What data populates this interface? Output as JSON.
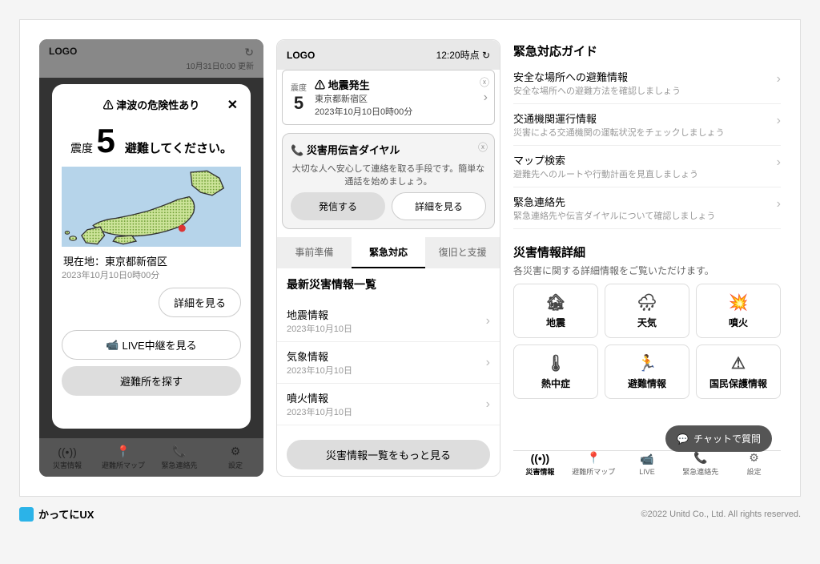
{
  "phone1": {
    "logo": "LOGO",
    "updated": "10月31日0:00 更新",
    "modal": {
      "header": "津波の危険性あり",
      "level_label": "震度",
      "level_num": "5",
      "evac_msg": "避難してください。",
      "loc_label": "現在地：東京都新宿区",
      "time": "2023年10月10日0時00分",
      "detail_btn": "詳細を見る",
      "live_btn": "LIVE中継を見る",
      "shelter_btn": "避難所を探す"
    },
    "tabs": [
      "災害情報",
      "避難所マップ",
      "緊急連絡先",
      "設定"
    ]
  },
  "phone2": {
    "logo": "LOGO",
    "time": "12:20時点",
    "alert": {
      "level_label": "震度",
      "level_num": "5",
      "title": "地震発生",
      "loc": "東京都新宿区",
      "time": "2023年10月10日0時00分"
    },
    "dengon": {
      "title": "災害用伝言ダイヤル",
      "desc": "大切な人へ安心して連絡を取る手段です。簡単な通話を始めましょう。",
      "call": "発信する",
      "detail": "詳細を見る"
    },
    "tabs": [
      "事前準備",
      "緊急対応",
      "復旧と支援"
    ],
    "list_title": "最新災害情報一覧",
    "list": [
      {
        "t": "地震情報",
        "d": "2023年10月10日"
      },
      {
        "t": "気象情報",
        "d": "2023年10月10日"
      },
      {
        "t": "噴火情報",
        "d": "2023年10月10日"
      }
    ],
    "more": "災害情報一覧をもっと見る"
  },
  "panel3": {
    "guide_title": "緊急対応ガイド",
    "guides": [
      {
        "t": "安全な場所への避難情報",
        "d": "安全な場所への避難方法を確認しましょう"
      },
      {
        "t": "交通機関運行情報",
        "d": "災害による交通機関の運転状況をチェックしましょう"
      },
      {
        "t": "マップ検索",
        "d": "避難先へのルートや行動計画を見直しましょう"
      },
      {
        "t": "緊急連絡先",
        "d": "緊急連絡先や伝言ダイヤルについて確認しましょう"
      }
    ],
    "detail_title": "災害情報詳細",
    "detail_sub": "各災害に関する詳細情報をご覧いただけます。",
    "grid": [
      {
        "ico": "🏚",
        "t": "地震"
      },
      {
        "ico": "🌧",
        "t": "天気"
      },
      {
        "ico": "💥",
        "t": "噴火"
      },
      {
        "ico": "🌡",
        "t": "熱中症"
      },
      {
        "ico": "🏃",
        "t": "避難情報"
      },
      {
        "ico": "⚠",
        "t": "国民保護情報"
      }
    ],
    "chat": "チャットで質問",
    "tabs": [
      "災害情報",
      "避難所マップ",
      "LIVE",
      "緊急連絡先",
      "設定"
    ]
  },
  "footer": {
    "brand": "かってにUX",
    "copy": "©2022 Unitd Co., Ltd. All rights reserved."
  }
}
